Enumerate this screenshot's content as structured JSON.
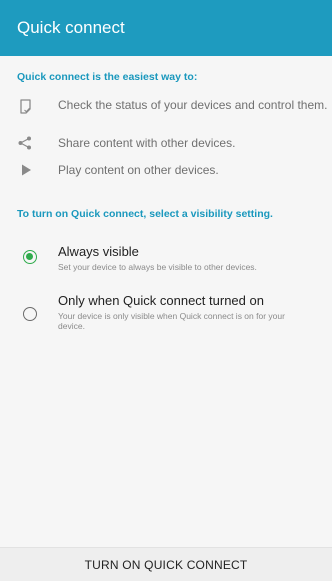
{
  "app_bar": {
    "title": "Quick connect",
    "color": "#1e9bbf"
  },
  "intro": {
    "heading": "Quick connect is the easiest way to:",
    "features": [
      {
        "icon": "device-status-icon",
        "text": "Check the status of your devices and control them."
      },
      {
        "icon": "share-icon",
        "text": "Share content with other devices."
      },
      {
        "icon": "play-icon",
        "text": "Play content on other devices."
      }
    ]
  },
  "visibility": {
    "heading": "To turn on Quick connect, select a visibility setting.",
    "options": [
      {
        "title": "Always visible",
        "description": "Set your device to always be visible to other devices.",
        "selected": true
      },
      {
        "title": "Only when Quick connect turned on",
        "description": "Your device is only visible when Quick connect is on for your device.",
        "selected": false
      }
    ]
  },
  "bottom": {
    "button_label": "TURN ON QUICK CONNECT"
  },
  "colors": {
    "accent": "#1a98bd",
    "radio_selected": "#2fab4c"
  }
}
